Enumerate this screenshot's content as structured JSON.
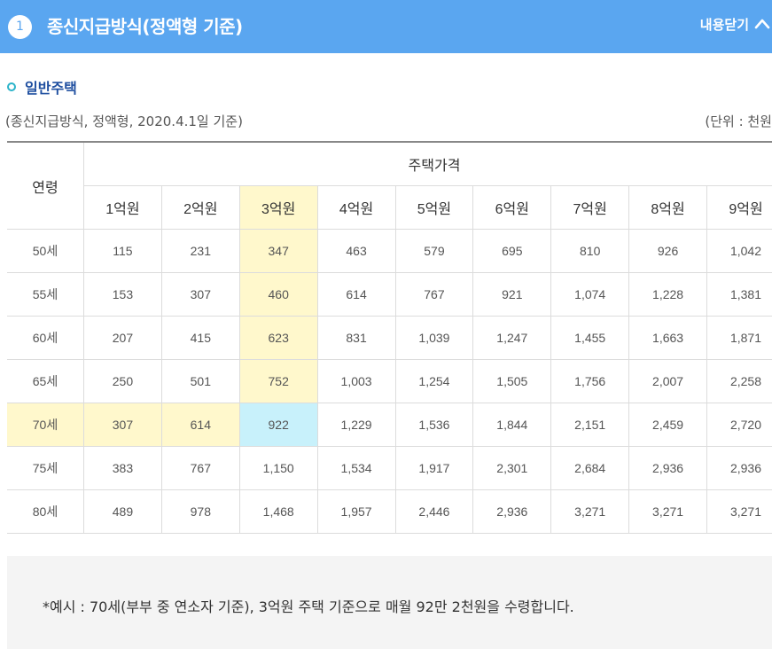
{
  "header": {
    "number": "1",
    "title": "종신지급방식(정액형 기준)",
    "toggle_label": "내용닫기",
    "toggle_icon": "chevron-up-icon"
  },
  "section": {
    "title": "일반주택",
    "description": "(종신지급방식, 정액형, 2020.4.1일 기준)",
    "unit": "(단위 : 천원"
  },
  "table": {
    "age_header": "연령",
    "price_header": "주택가격",
    "columns": [
      "1억원",
      "2억원",
      "3억원",
      "4억원",
      "5억원",
      "6억원",
      "7억원",
      "8억원",
      "9억원"
    ],
    "rows": [
      {
        "age": "50세",
        "values": [
          "115",
          "231",
          "347",
          "463",
          "579",
          "695",
          "810",
          "926",
          "1,042"
        ]
      },
      {
        "age": "55세",
        "values": [
          "153",
          "307",
          "460",
          "614",
          "767",
          "921",
          "1,074",
          "1,228",
          "1,381"
        ]
      },
      {
        "age": "60세",
        "values": [
          "207",
          "415",
          "623",
          "831",
          "1,039",
          "1,247",
          "1,455",
          "1,663",
          "1,871"
        ]
      },
      {
        "age": "65세",
        "values": [
          "250",
          "501",
          "752",
          "1,003",
          "1,254",
          "1,505",
          "1,756",
          "2,007",
          "2,258"
        ]
      },
      {
        "age": "70세",
        "values": [
          "307",
          "614",
          "922",
          "1,229",
          "1,536",
          "1,844",
          "2,151",
          "2,459",
          "2,720"
        ]
      },
      {
        "age": "75세",
        "values": [
          "383",
          "767",
          "1,150",
          "1,534",
          "1,917",
          "2,301",
          "2,684",
          "2,936",
          "2,936"
        ]
      },
      {
        "age": "80세",
        "values": [
          "489",
          "978",
          "1,468",
          "1,957",
          "2,446",
          "2,936",
          "3,271",
          "3,271",
          "3,271"
        ]
      }
    ],
    "highlight_column_index": 2,
    "highlight_row_index": 4,
    "highlight_color": "#fff8cc",
    "intersect_color": "#c8f1fb"
  },
  "note": "*예시 : 70세(부부 중 연소자 기준), 3억원 주택 기준으로 매월 92만 2천원을 수령합니다.",
  "colors": {
    "header_bg": "#5aa6f0",
    "section_title": "#1f4fa0",
    "bullet": "#2bb3c9"
  }
}
